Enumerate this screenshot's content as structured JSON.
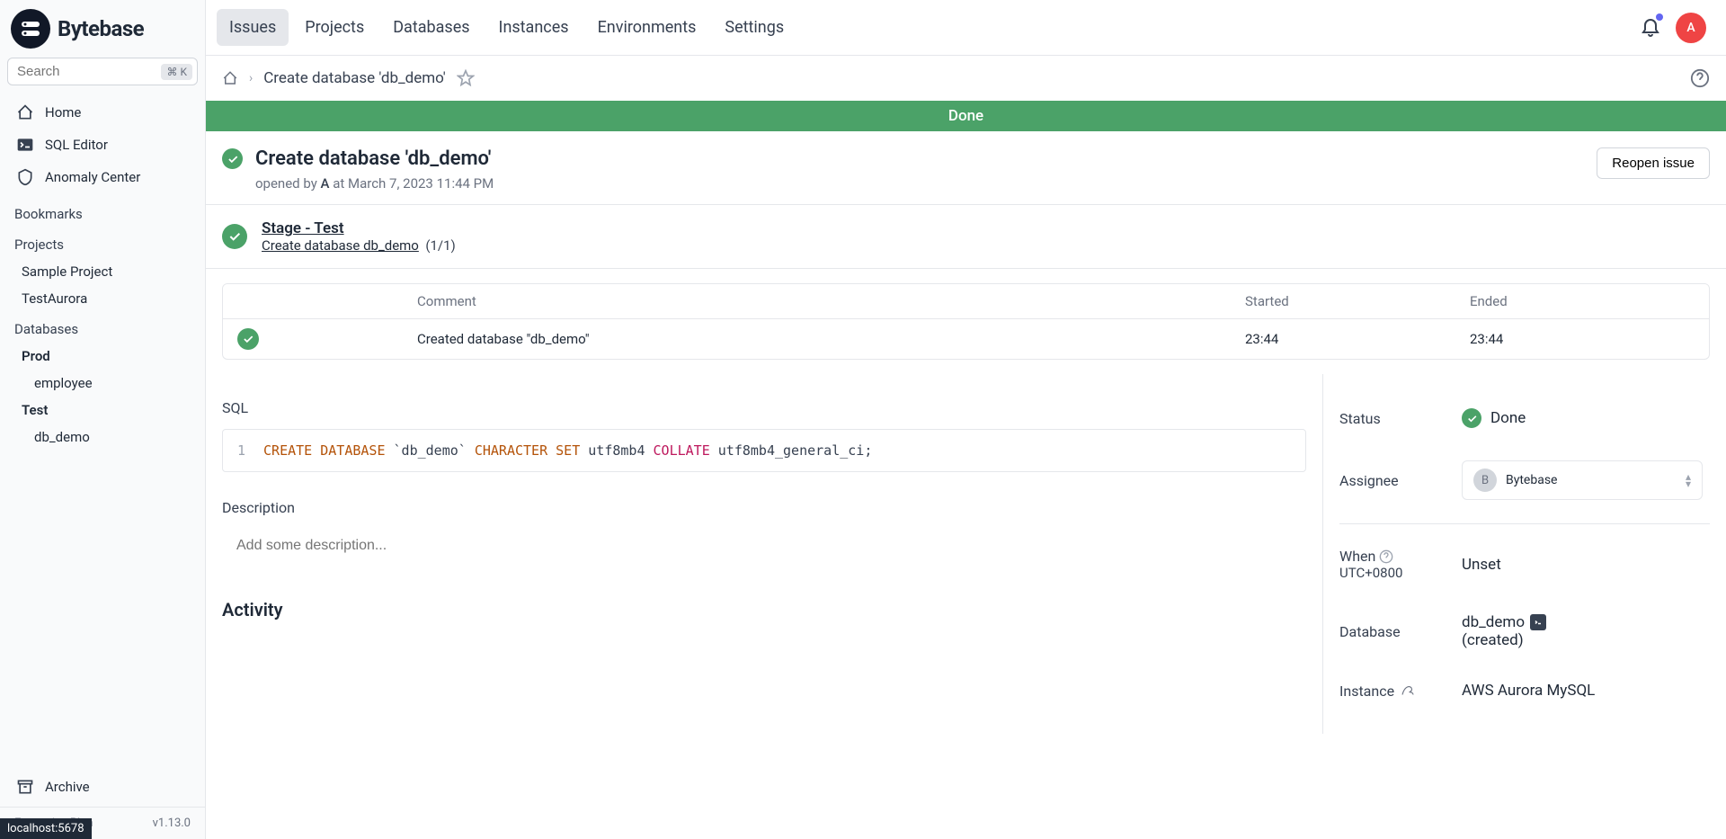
{
  "brand": "Bytebase",
  "search": {
    "placeholder": "Search",
    "kbd": "⌘ K"
  },
  "nav": {
    "home": "Home",
    "sql_editor": "SQL Editor",
    "anomaly_center": "Anomaly Center",
    "bookmarks": "Bookmarks",
    "projects_heading": "Projects",
    "projects": [
      "Sample Project",
      "TestAurora"
    ],
    "databases_heading": "Databases",
    "db_envs": [
      {
        "name": "Prod",
        "dbs": [
          "employee"
        ]
      },
      {
        "name": "Test",
        "dbs": [
          "db_demo"
        ]
      }
    ],
    "archive": "Archive"
  },
  "footer": {
    "plan": "Enterprise Plan",
    "version": "v1.13.0",
    "localhost": "localhost:5678"
  },
  "tabs": [
    "Issues",
    "Projects",
    "Databases",
    "Instances",
    "Environments",
    "Settings"
  ],
  "avatar_letter": "A",
  "breadcrumb": "Create database 'db_demo'",
  "banner": "Done",
  "issue": {
    "title": "Create database 'db_demo'",
    "opened_prefix": "opened by",
    "opened_user": "A",
    "opened_suffix": "at March 7, 2023 11:44 PM",
    "reopen": "Reopen issue"
  },
  "stage": {
    "title": "Stage - Test",
    "task": "Create database db_demo",
    "count": "(1/1)"
  },
  "task_table": {
    "col_comment": "Comment",
    "col_started": "Started",
    "col_ended": "Ended",
    "row": {
      "comment": "Created database \"db_demo\"",
      "started": "23:44",
      "ended": "23:44"
    }
  },
  "sql": {
    "label": "SQL",
    "line_no": "1",
    "tokens": {
      "create": "CREATE",
      "database": "DATABASE",
      "name": "`db_demo`",
      "character": "CHARACTER",
      "set": "SET",
      "charset": "utf8mb4",
      "collate": "COLLATE",
      "collation": "utf8mb4_general_ci;"
    }
  },
  "description": {
    "label": "Description",
    "placeholder": "Add some description..."
  },
  "activity": "Activity",
  "meta": {
    "status_label": "Status",
    "status_value": "Done",
    "assignee_label": "Assignee",
    "assignee_value": "Bytebase",
    "assignee_initial": "B",
    "when_label": "When",
    "when_tz": "UTC+0800",
    "when_value": "Unset",
    "database_label": "Database",
    "database_value": "db_demo",
    "database_status": "(created)",
    "instance_label": "Instance",
    "instance_value": "AWS Aurora MySQL"
  }
}
